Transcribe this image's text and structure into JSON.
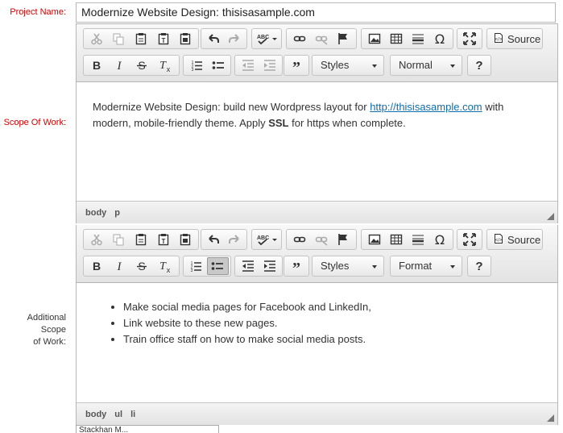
{
  "fields": {
    "project_name_label": "Project Name:",
    "project_name_value": "Modernize Website Design: thisisasample.com",
    "scope_label": "Scope Of Work:",
    "additional_label_line1": "Additional Scope",
    "additional_label_line2": "of Work:"
  },
  "toolbar": {
    "source_label": "Source",
    "styles_label": "Styles",
    "editor1_format_label": "Normal",
    "editor2_format_label": "Format",
    "help_label": "?"
  },
  "editor1": {
    "text_before_link": "Modernize Website Design: build new Wordpress layout for ",
    "link_text": "http://thisisasample.com",
    "text_after_link": " with modern, mobile-friendly theme. Apply ",
    "bold_text": "SSL",
    "text_end": " for https when complete.",
    "path": [
      "body",
      "p"
    ]
  },
  "editor2": {
    "items": [
      "Make social media pages for Facebook and LinkedIn,",
      "Link website to these new pages.",
      "Train office staff on how to make social media posts."
    ],
    "path": [
      "body",
      "ul",
      "li"
    ]
  },
  "cutoff_text": "Stackhan M...",
  "icons": [
    "cut-icon",
    "copy-icon",
    "paste-icon",
    "paste-text-icon",
    "paste-word-icon",
    "undo-icon",
    "redo-icon",
    "spellcheck-icon",
    "link-icon",
    "unlink-icon",
    "anchor-icon",
    "image-icon",
    "table-icon",
    "horizontal-rule-icon",
    "special-char-icon",
    "maximize-icon",
    "source-icon",
    "bold-icon",
    "italic-icon",
    "strike-icon",
    "remove-format-icon",
    "numbered-list-icon",
    "bulleted-list-icon",
    "outdent-icon",
    "indent-icon",
    "blockquote-icon"
  ],
  "colors": {
    "label_red": "#d20000",
    "link": "#0e6eae"
  }
}
